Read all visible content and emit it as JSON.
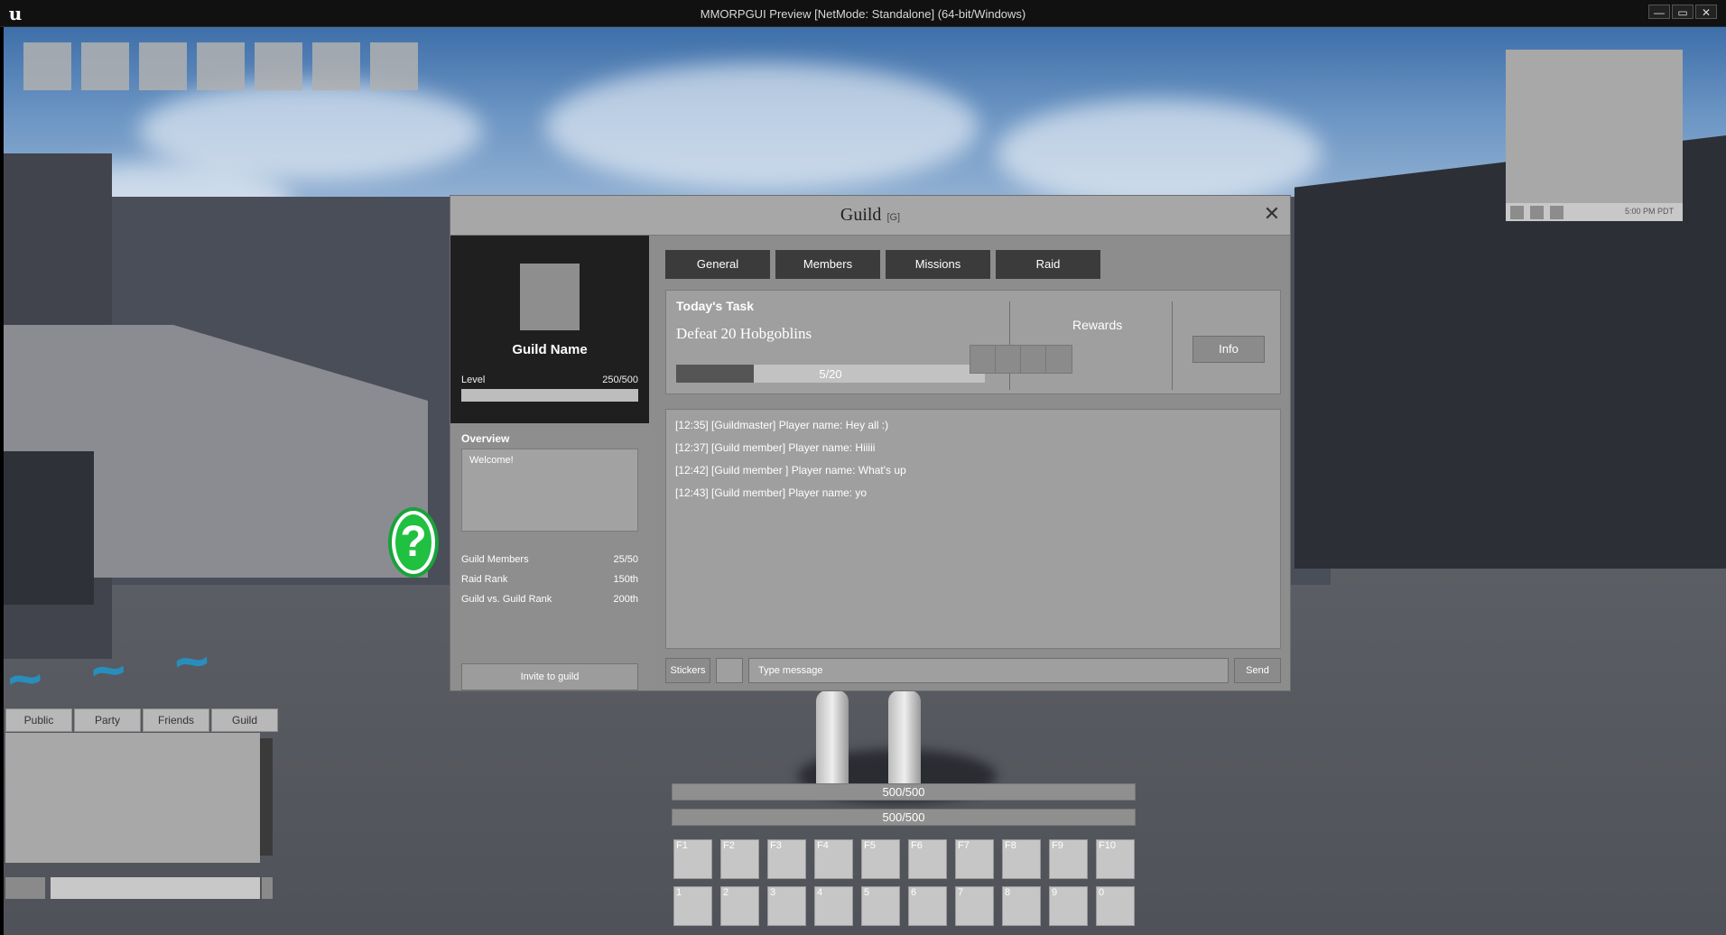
{
  "window": {
    "title": "MMORPGUI Preview [NetMode: Standalone]  (64-bit/Windows)",
    "logo": "u",
    "min_label": "—",
    "max_label": "▭",
    "close_label": "✕"
  },
  "minimap": {
    "time": "5:00 PM PDT"
  },
  "guild": {
    "title": "Guild",
    "hotkey": "[G]",
    "close_label": "✕",
    "name": "Guild Name",
    "level_label": "Level",
    "level_value": "250/500",
    "level_fraction": 0.5,
    "overview_label": "Overview",
    "overview_text": "Welcome!",
    "stats": [
      {
        "label": "Guild Members",
        "value": "25/50"
      },
      {
        "label": "Raid Rank",
        "value": "150th"
      },
      {
        "label": "Guild vs. Guild Rank",
        "value": "200th"
      }
    ],
    "invite_label": "Invite to guild",
    "tabs": [
      "General",
      "Members",
      "Missions",
      "Raid"
    ],
    "task": {
      "title": "Today's Task",
      "description": "Defeat 20 Hobgoblins",
      "progress_text": "5/20",
      "progress_fraction": 0.25,
      "rewards_label": "Rewards",
      "info_label": "Info"
    },
    "chat": [
      "[12:35] [Guildmaster] Player name: Hey all :)",
      "[12:37] [Guild member] Player name: Hiiiii",
      "[12:42] [Guild member ] Player name: What's up",
      "[12:43] [Guild member] Player name: yo"
    ],
    "stickers_label": "Stickers",
    "message_placeholder": "Type message",
    "send_label": "Send"
  },
  "chat_tabs": [
    "Public",
    "Party",
    "Friends",
    "Guild"
  ],
  "hud": {
    "health_text": "500/500",
    "mana_text": "500/500",
    "skill_row1": [
      "F1",
      "F2",
      "F3",
      "F4",
      "F5",
      "F6",
      "F7",
      "F8",
      "F9",
      "F10"
    ],
    "skill_row2": [
      "1",
      "2",
      "3",
      "4",
      "5",
      "6",
      "7",
      "8",
      "9",
      "0"
    ]
  },
  "icons": {
    "quest_marker": "question-mark-icon",
    "close": "close-icon"
  }
}
